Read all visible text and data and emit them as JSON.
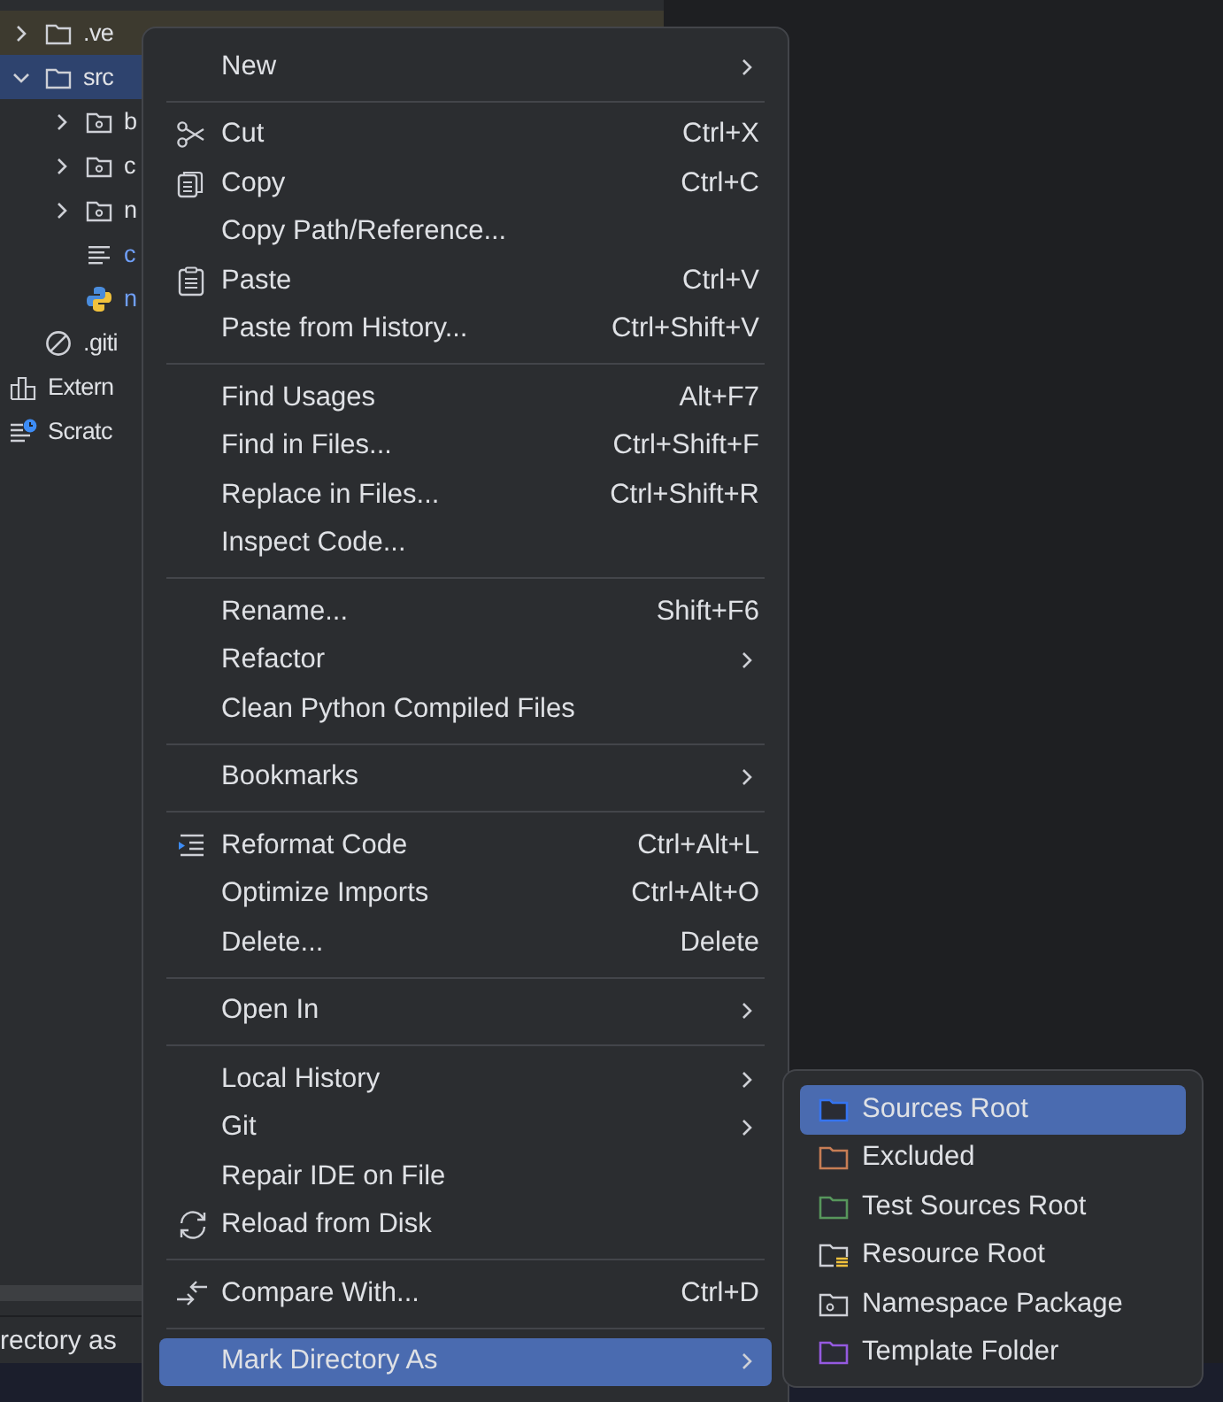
{
  "tree": [
    {
      "label": ".ve",
      "kind": "excluded-folder",
      "expanded": false,
      "selected": false,
      "color": "#dfe1e5"
    },
    {
      "label": "src",
      "kind": "folder",
      "expanded": true,
      "selected": true,
      "color": "#dfe1e5",
      "children": [
        {
          "label": "b",
          "kind": "package",
          "expanded": false,
          "selected": false,
          "color": "#dfe1e5"
        },
        {
          "label": "c",
          "kind": "package",
          "expanded": false,
          "selected": false,
          "color": "#dfe1e5"
        },
        {
          "label": "n",
          "kind": "package",
          "expanded": false,
          "selected": false,
          "color": "#dfe1e5"
        },
        {
          "label": "c",
          "kind": "text-file",
          "selected": false,
          "color": "#6f9ff8"
        },
        {
          "label": "n",
          "kind": "python-file",
          "selected": false,
          "color": "#6f9ff8"
        }
      ]
    },
    {
      "label": ".giti",
      "kind": "ignore-file",
      "selected": false,
      "color": "#dfe1e5"
    },
    {
      "label": "Extern",
      "kind": "libraries",
      "selected": false,
      "color": "#dfe1e5"
    },
    {
      "label": "Scratc",
      "kind": "scratches",
      "selected": false,
      "color": "#dfe1e5"
    }
  ],
  "status_bar": {
    "text": "rectory as"
  },
  "context_menu": {
    "items": [
      {
        "kind": "plain",
        "label": "New",
        "submenu": true,
        "selected": false
      },
      {
        "kind": "separator"
      },
      {
        "kind": "scissors",
        "label": "Cut",
        "shortcut": "Ctrl+X",
        "submenu": false,
        "selected": false
      },
      {
        "kind": "copy",
        "label": "Copy",
        "shortcut": "Ctrl+C",
        "submenu": false,
        "selected": false
      },
      {
        "kind": "plain",
        "label": "Copy Path/Reference...",
        "submenu": false,
        "selected": false
      },
      {
        "kind": "paste",
        "label": "Paste",
        "shortcut": "Ctrl+V",
        "submenu": false,
        "selected": false
      },
      {
        "kind": "plain",
        "label": "Paste from History...",
        "shortcut": "Ctrl+Shift+V",
        "submenu": false,
        "selected": false
      },
      {
        "kind": "separator"
      },
      {
        "kind": "plain",
        "label": "Find Usages",
        "shortcut": "Alt+F7",
        "submenu": false,
        "selected": false
      },
      {
        "kind": "plain",
        "label": "Find in Files...",
        "shortcut": "Ctrl+Shift+F",
        "submenu": false,
        "selected": false
      },
      {
        "kind": "plain",
        "label": "Replace in Files...",
        "shortcut": "Ctrl+Shift+R",
        "submenu": false,
        "selected": false
      },
      {
        "kind": "plain",
        "label": "Inspect Code...",
        "submenu": false,
        "selected": false
      },
      {
        "kind": "separator"
      },
      {
        "kind": "plain",
        "label": "Rename...",
        "shortcut": "Shift+F6",
        "submenu": false,
        "selected": false
      },
      {
        "kind": "plain",
        "label": "Refactor",
        "submenu": true,
        "selected": false
      },
      {
        "kind": "plain",
        "label": "Clean Python Compiled Files",
        "submenu": false,
        "selected": false
      },
      {
        "kind": "separator"
      },
      {
        "kind": "plain",
        "label": "Bookmarks",
        "submenu": true,
        "selected": false
      },
      {
        "kind": "separator"
      },
      {
        "kind": "reformat",
        "label": "Reformat Code",
        "shortcut": "Ctrl+Alt+L",
        "submenu": false,
        "selected": false
      },
      {
        "kind": "plain",
        "label": "Optimize Imports",
        "shortcut": "Ctrl+Alt+O",
        "submenu": false,
        "selected": false
      },
      {
        "kind": "plain",
        "label": "Delete...",
        "shortcut": "Delete",
        "submenu": false,
        "selected": false
      },
      {
        "kind": "separator"
      },
      {
        "kind": "plain",
        "label": "Open In",
        "submenu": true,
        "selected": false
      },
      {
        "kind": "separator"
      },
      {
        "kind": "plain",
        "label": "Local History",
        "submenu": true,
        "selected": false
      },
      {
        "kind": "plain",
        "label": "Git",
        "submenu": true,
        "selected": false
      },
      {
        "kind": "plain",
        "label": "Repair IDE on File",
        "submenu": false,
        "selected": false
      },
      {
        "kind": "reload",
        "label": "Reload from Disk",
        "submenu": false,
        "selected": false
      },
      {
        "kind": "separator"
      },
      {
        "kind": "compare",
        "label": "Compare With...",
        "shortcut": "Ctrl+D",
        "submenu": false,
        "selected": false
      },
      {
        "kind": "separator"
      },
      {
        "kind": "plain",
        "label": "Mark Directory As",
        "submenu": true,
        "selected": true
      }
    ]
  },
  "submenu": {
    "items": [
      {
        "kind": "folder",
        "label": "Sources Root",
        "color": "#3574f0",
        "selected": true
      },
      {
        "kind": "folder",
        "label": "Excluded",
        "color": "#c77d55",
        "selected": false
      },
      {
        "kind": "folder",
        "label": "Test Sources Root",
        "color": "#57965c",
        "selected": false
      },
      {
        "kind": "resource",
        "label": "Resource Root",
        "selected": false
      },
      {
        "kind": "namespace",
        "label": "Namespace Package",
        "selected": false
      },
      {
        "kind": "folder",
        "label": "Template Folder",
        "color": "#955ae0",
        "selected": false
      }
    ]
  }
}
